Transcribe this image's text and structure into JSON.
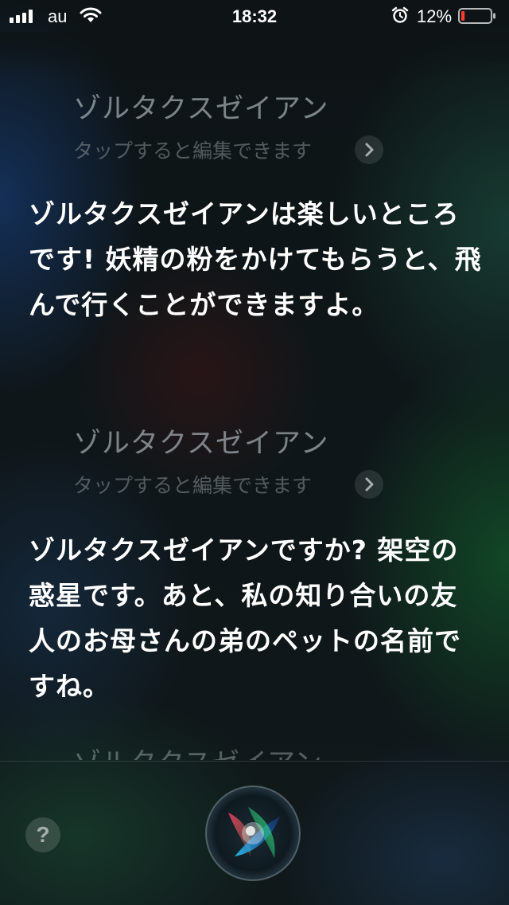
{
  "status_bar": {
    "carrier": "au",
    "time": "18:32",
    "battery_percent": "12%",
    "battery_level": 0.12,
    "battery_color": "#ff3b30",
    "icons": [
      "cellular-signal-icon",
      "wifi-icon",
      "alarm-icon",
      "battery-icon"
    ]
  },
  "conversation": [
    {
      "query": "ゾルタクスゼイアン",
      "hint": "タップすると編集できます",
      "answer": "ゾルタクスゼイアンは楽しいところです! 妖精の粉をかけてもらうと、飛んで行くことができますよ。"
    },
    {
      "query": "ゾルタクスゼイアン",
      "hint": "タップすると編集できます",
      "answer": "ゾルタクスゼイアンですか? 架空の惑星です。あと、私の知り合いの友人のお母さんの弟のペットの名前ですね。"
    }
  ],
  "partial_query": "ゾルタクスゼイアン",
  "bottom_bar": {
    "help_label": "?",
    "siri_button": "siri-orb-icon"
  }
}
